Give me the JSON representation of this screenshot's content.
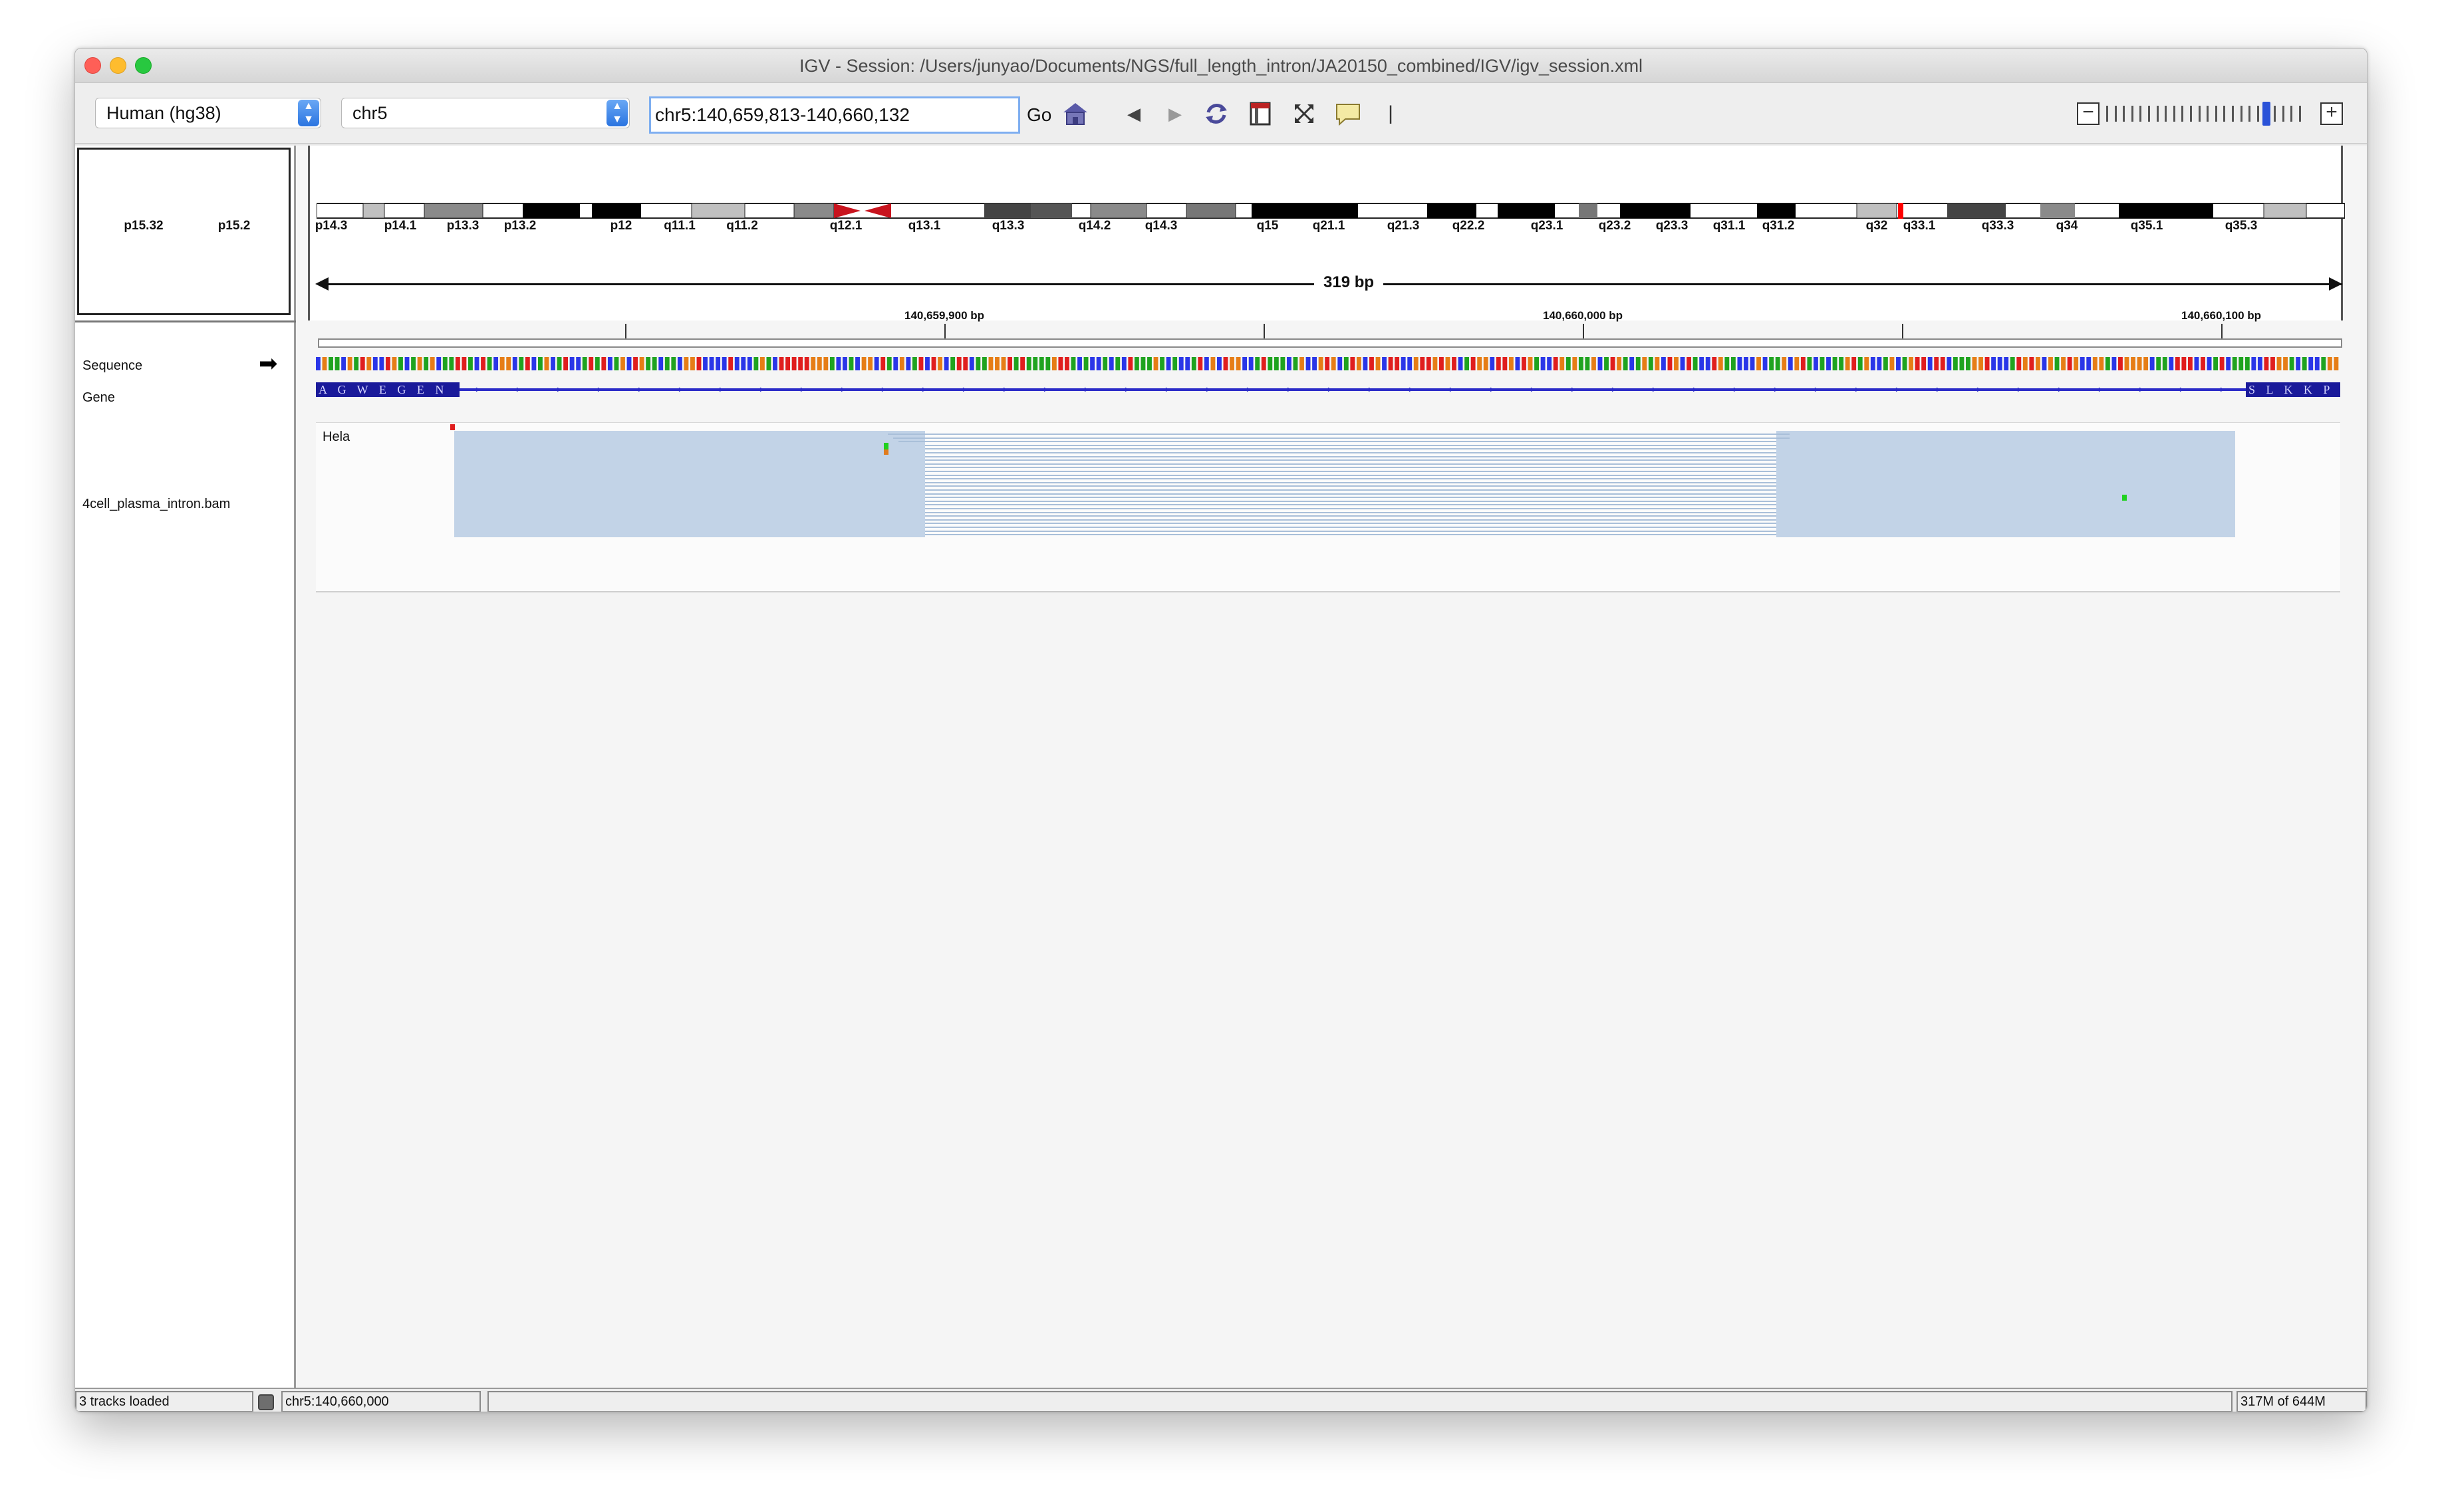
{
  "window": {
    "title": "IGV - Session: /Users/junyao/Documents/NGS/full_length_intron/JA20150_combined/IGV/igv_session.xml"
  },
  "toolbar": {
    "genome": "Human (hg38)",
    "chromosome": "chr5",
    "locus": "chr5:140,659,813-140,660,132",
    "go_label": "Go",
    "icons": [
      "home-icon",
      "back-icon",
      "forward-icon",
      "refresh-icon",
      "roi-icon",
      "resize-icon",
      "popup-info-icon"
    ]
  },
  "ideogram": {
    "bands": [
      "p15.32",
      "p15.2",
      "p14.3",
      "p14.1",
      "p13.3",
      "p13.2",
      "p12",
      "q11.1",
      "q11.2",
      "q12.1",
      "q13.1",
      "q13.3",
      "q14.2",
      "q14.3",
      "q15",
      "q21.1",
      "q21.3",
      "q22.2",
      "q23.1",
      "q23.2",
      "q23.3",
      "q31.1",
      "q31.2",
      "q32",
      "q33.1",
      "q33.3",
      "q34",
      "q35.1",
      "q35.3"
    ]
  },
  "ruler": {
    "span_label": "319 bp",
    "labels": [
      "140,659,900 bp",
      "140,660,000 bp",
      "140,660,100 bp"
    ]
  },
  "tracks": {
    "sequence": "Sequence",
    "gene": "Gene",
    "bam": "4cell_plasma_intron.bam",
    "sample_label": "Hela",
    "gene_left_aa": "A G W E G E N",
    "gene_right_aa": "S L K K P E"
  },
  "status": {
    "tracks_loaded": "3 tracks loaded",
    "position": "chr5:140,660,000",
    "message": "",
    "memory": "317M of 644M"
  },
  "colors": {
    "accent": "#2a74e0",
    "coverage": "#c2d3e7",
    "gene": "#1a1a9a",
    "centromere": "#c8141e"
  }
}
